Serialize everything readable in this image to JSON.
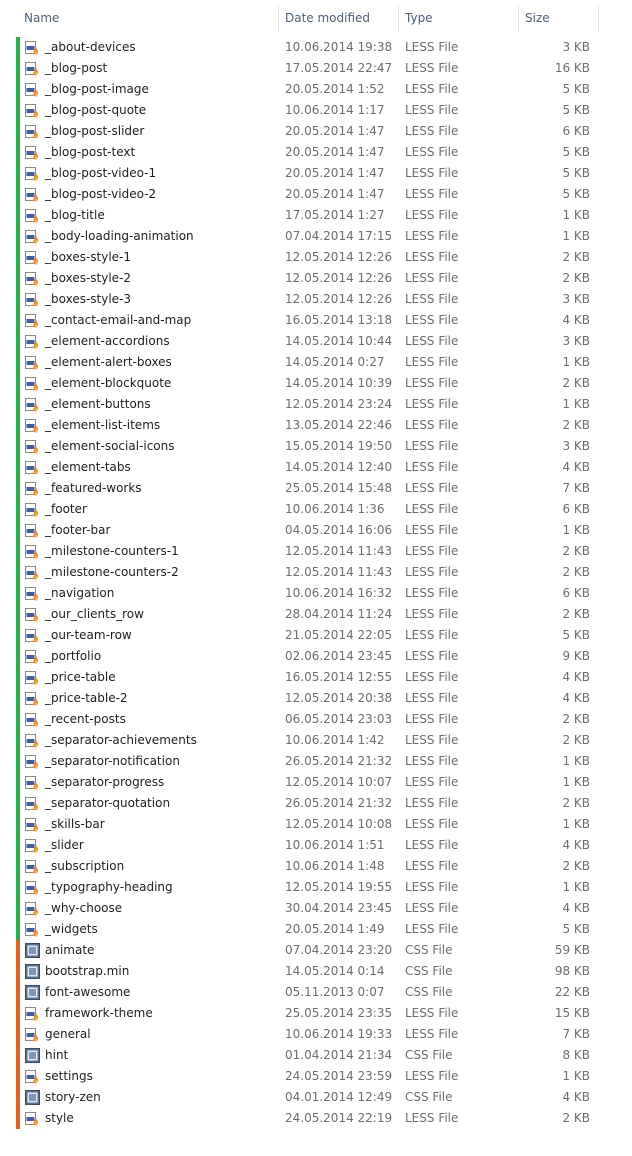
{
  "columns": {
    "name": "Name",
    "date": "Date modified",
    "type": "Type",
    "size": "Size"
  },
  "group_colors": {
    "less": "#22b24c",
    "css": "#e8621d"
  },
  "files": [
    {
      "name": "_about-devices",
      "date": "10.06.2014 19:38",
      "type": "LESS File",
      "size": "3 KB",
      "icon": "less-file-icon",
      "group": "less"
    },
    {
      "name": "_blog-post",
      "date": "17.05.2014 22:47",
      "type": "LESS File",
      "size": "16 KB",
      "icon": "less-file-icon",
      "group": "less"
    },
    {
      "name": "_blog-post-image",
      "date": "20.05.2014 1:52",
      "type": "LESS File",
      "size": "5 KB",
      "icon": "less-file-icon",
      "group": "less"
    },
    {
      "name": "_blog-post-quote",
      "date": "10.06.2014 1:17",
      "type": "LESS File",
      "size": "5 KB",
      "icon": "less-file-icon",
      "group": "less"
    },
    {
      "name": "_blog-post-slider",
      "date": "20.05.2014 1:47",
      "type": "LESS File",
      "size": "6 KB",
      "icon": "less-file-icon",
      "group": "less"
    },
    {
      "name": "_blog-post-text",
      "date": "20.05.2014 1:47",
      "type": "LESS File",
      "size": "5 KB",
      "icon": "less-file-icon",
      "group": "less"
    },
    {
      "name": "_blog-post-video-1",
      "date": "20.05.2014 1:47",
      "type": "LESS File",
      "size": "5 KB",
      "icon": "less-file-icon",
      "group": "less"
    },
    {
      "name": "_blog-post-video-2",
      "date": "20.05.2014 1:47",
      "type": "LESS File",
      "size": "5 KB",
      "icon": "less-file-icon",
      "group": "less"
    },
    {
      "name": "_blog-title",
      "date": "17.05.2014 1:27",
      "type": "LESS File",
      "size": "1 KB",
      "icon": "less-file-icon",
      "group": "less"
    },
    {
      "name": "_body-loading-animation",
      "date": "07.04.2014 17:15",
      "type": "LESS File",
      "size": "1 KB",
      "icon": "less-file-icon",
      "group": "less"
    },
    {
      "name": "_boxes-style-1",
      "date": "12.05.2014 12:26",
      "type": "LESS File",
      "size": "2 KB",
      "icon": "less-file-icon",
      "group": "less"
    },
    {
      "name": "_boxes-style-2",
      "date": "12.05.2014 12:26",
      "type": "LESS File",
      "size": "2 KB",
      "icon": "less-file-icon",
      "group": "less"
    },
    {
      "name": "_boxes-style-3",
      "date": "12.05.2014 12:26",
      "type": "LESS File",
      "size": "3 KB",
      "icon": "less-file-icon",
      "group": "less"
    },
    {
      "name": "_contact-email-and-map",
      "date": "16.05.2014 13:18",
      "type": "LESS File",
      "size": "4 KB",
      "icon": "less-file-icon",
      "group": "less"
    },
    {
      "name": "_element-accordions",
      "date": "14.05.2014 10:44",
      "type": "LESS File",
      "size": "3 KB",
      "icon": "less-file-icon",
      "group": "less"
    },
    {
      "name": "_element-alert-boxes",
      "date": "14.05.2014 0:27",
      "type": "LESS File",
      "size": "1 KB",
      "icon": "less-file-icon",
      "group": "less"
    },
    {
      "name": "_element-blockquote",
      "date": "14.05.2014 10:39",
      "type": "LESS File",
      "size": "2 KB",
      "icon": "less-file-icon",
      "group": "less"
    },
    {
      "name": "_element-buttons",
      "date": "12.05.2014 23:24",
      "type": "LESS File",
      "size": "1 KB",
      "icon": "less-file-icon",
      "group": "less"
    },
    {
      "name": "_element-list-items",
      "date": "13.05.2014 22:46",
      "type": "LESS File",
      "size": "2 KB",
      "icon": "less-file-icon",
      "group": "less"
    },
    {
      "name": "_element-social-icons",
      "date": "15.05.2014 19:50",
      "type": "LESS File",
      "size": "3 KB",
      "icon": "less-file-icon",
      "group": "less"
    },
    {
      "name": "_element-tabs",
      "date": "14.05.2014 12:40",
      "type": "LESS File",
      "size": "4 KB",
      "icon": "less-file-icon",
      "group": "less"
    },
    {
      "name": "_featured-works",
      "date": "25.05.2014 15:48",
      "type": "LESS File",
      "size": "7 KB",
      "icon": "less-file-icon",
      "group": "less"
    },
    {
      "name": "_footer",
      "date": "10.06.2014 1:36",
      "type": "LESS File",
      "size": "6 KB",
      "icon": "less-file-icon",
      "group": "less"
    },
    {
      "name": "_footer-bar",
      "date": "04.05.2014 16:06",
      "type": "LESS File",
      "size": "1 KB",
      "icon": "less-file-icon",
      "group": "less"
    },
    {
      "name": "_milestone-counters-1",
      "date": "12.05.2014 11:43",
      "type": "LESS File",
      "size": "2 KB",
      "icon": "less-file-icon",
      "group": "less"
    },
    {
      "name": "_milestone-counters-2",
      "date": "12.05.2014 11:43",
      "type": "LESS File",
      "size": "2 KB",
      "icon": "less-file-icon",
      "group": "less"
    },
    {
      "name": "_navigation",
      "date": "10.06.2014 16:32",
      "type": "LESS File",
      "size": "6 KB",
      "icon": "less-file-icon",
      "group": "less"
    },
    {
      "name": "_our_clients_row",
      "date": "28.04.2014 11:24",
      "type": "LESS File",
      "size": "2 KB",
      "icon": "less-file-icon",
      "group": "less"
    },
    {
      "name": "_our-team-row",
      "date": "21.05.2014 22:05",
      "type": "LESS File",
      "size": "5 KB",
      "icon": "less-file-icon",
      "group": "less"
    },
    {
      "name": "_portfolio",
      "date": "02.06.2014 23:45",
      "type": "LESS File",
      "size": "9 KB",
      "icon": "less-file-icon",
      "group": "less"
    },
    {
      "name": "_price-table",
      "date": "16.05.2014 12:55",
      "type": "LESS File",
      "size": "4 KB",
      "icon": "less-file-icon",
      "group": "less"
    },
    {
      "name": "_price-table-2",
      "date": "12.05.2014 20:38",
      "type": "LESS File",
      "size": "4 KB",
      "icon": "less-file-icon",
      "group": "less"
    },
    {
      "name": "_recent-posts",
      "date": "06.05.2014 23:03",
      "type": "LESS File",
      "size": "2 KB",
      "icon": "less-file-icon",
      "group": "less"
    },
    {
      "name": "_separator-achievements",
      "date": "10.06.2014 1:42",
      "type": "LESS File",
      "size": "2 KB",
      "icon": "less-file-icon",
      "group": "less"
    },
    {
      "name": "_separator-notification",
      "date": "26.05.2014 21:32",
      "type": "LESS File",
      "size": "1 KB",
      "icon": "less-file-icon",
      "group": "less"
    },
    {
      "name": "_separator-progress",
      "date": "12.05.2014 10:07",
      "type": "LESS File",
      "size": "1 KB",
      "icon": "less-file-icon",
      "group": "less"
    },
    {
      "name": "_separator-quotation",
      "date": "26.05.2014 21:32",
      "type": "LESS File",
      "size": "2 KB",
      "icon": "less-file-icon",
      "group": "less"
    },
    {
      "name": "_skills-bar",
      "date": "12.05.2014 10:08",
      "type": "LESS File",
      "size": "1 KB",
      "icon": "less-file-icon",
      "group": "less"
    },
    {
      "name": "_slider",
      "date": "10.06.2014 1:51",
      "type": "LESS File",
      "size": "4 KB",
      "icon": "less-file-icon",
      "group": "less"
    },
    {
      "name": "_subscription",
      "date": "10.06.2014 1:48",
      "type": "LESS File",
      "size": "2 KB",
      "icon": "less-file-icon",
      "group": "less"
    },
    {
      "name": "_typography-heading",
      "date": "12.05.2014 19:55",
      "type": "LESS File",
      "size": "1 KB",
      "icon": "less-file-icon",
      "group": "less"
    },
    {
      "name": "_why-choose",
      "date": "30.04.2014 23:45",
      "type": "LESS File",
      "size": "4 KB",
      "icon": "less-file-icon",
      "group": "less"
    },
    {
      "name": "_widgets",
      "date": "20.05.2014 1:49",
      "type": "LESS File",
      "size": "5 KB",
      "icon": "less-file-icon",
      "group": "less"
    },
    {
      "name": "animate",
      "date": "07.04.2014 23:20",
      "type": "CSS File",
      "size": "59 KB",
      "icon": "css-file-icon",
      "group": "css"
    },
    {
      "name": "bootstrap.min",
      "date": "14.05.2014 0:14",
      "type": "CSS File",
      "size": "98 KB",
      "icon": "css-file-icon",
      "group": "css"
    },
    {
      "name": "font-awesome",
      "date": "05.11.2013 0:07",
      "type": "CSS File",
      "size": "22 KB",
      "icon": "css-file-icon",
      "group": "css"
    },
    {
      "name": "framework-theme",
      "date": "25.05.2014 23:35",
      "type": "LESS File",
      "size": "15 KB",
      "icon": "less-file-icon",
      "group": "css"
    },
    {
      "name": "general",
      "date": "10.06.2014 19:33",
      "type": "LESS File",
      "size": "7 KB",
      "icon": "less-file-icon",
      "group": "css"
    },
    {
      "name": "hint",
      "date": "01.04.2014 21:34",
      "type": "CSS File",
      "size": "8 KB",
      "icon": "css-file-icon",
      "group": "css"
    },
    {
      "name": "settings",
      "date": "24.05.2014 23:59",
      "type": "LESS File",
      "size": "1 KB",
      "icon": "less-file-icon",
      "group": "css"
    },
    {
      "name": "story-zen",
      "date": "04.01.2014 12:49",
      "type": "CSS File",
      "size": "4 KB",
      "icon": "css-file-icon",
      "group": "css"
    },
    {
      "name": "style",
      "date": "24.05.2014 22:19",
      "type": "LESS File",
      "size": "2 KB",
      "icon": "less-file-icon",
      "group": "css"
    }
  ]
}
